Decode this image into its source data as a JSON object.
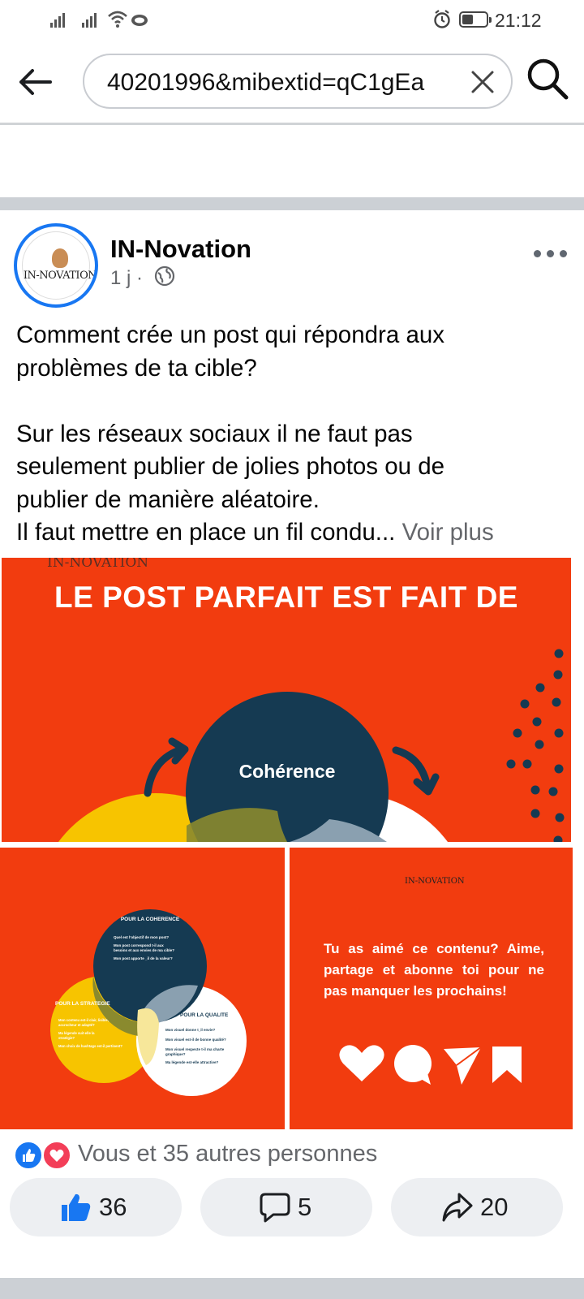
{
  "status_bar": {
    "time": "21:12",
    "icons": [
      "signal-icon",
      "signal-icon",
      "wifi-icon",
      "cloud-icon",
      "alarm-icon",
      "battery-icon"
    ]
  },
  "url_bar": {
    "url_text": "40201996&mibextid=qC1gEa",
    "icons": [
      "back-arrow-icon",
      "clear-icon",
      "search-icon"
    ]
  },
  "post": {
    "page_name": "IN-Novation",
    "avatar_text": "IN-NOVATION",
    "time_ago": "1 j",
    "separator": "·",
    "text_lines": [
      "Comment crée un post qui répondra aux",
      "problèmes de ta cible?",
      "",
      "Sur les réseaux sociaux il ne faut pas",
      "seulement publier de jolies photos ou de",
      "publier de manière aléatoire.",
      "Il faut mettre en place un fil condu..."
    ],
    "see_more": "Voir plus",
    "images": {
      "main": {
        "logo": "IN-NOVATION",
        "title": "LE POST PARFAIT EST FAIT DE",
        "circle_label": "Cohérence",
        "colors": {
          "background": "#f23c0f",
          "navy": "#153a52",
          "yellow": "#f7c400",
          "white": "#ffffff"
        }
      },
      "left": {
        "top_title": "POUR LA COHERENCE",
        "top_lines": [
          "Quel est l'objectif de mon post?",
          "Mon post correspond t-il aux",
          "besoins et aux envies de ma cible?",
          "Mon post apporte _il de la valeur?"
        ],
        "left_title": "POUR LA STRATEGIE",
        "left_lines": [
          "Mon contenu est-il clair, lisible,",
          "accrocheur et adapté?",
          "Ma légende suit-elle la",
          "stratégie?",
          "Mon choix de hashtags est-il pertinent?"
        ],
        "right_title": "POUR LA QUALITE",
        "right_lines": [
          "Mon visuel donne t_il envie?",
          "Mon visuel est-il de bonne qualité?",
          "Mon visuel respecte t-il ma charte",
          "graphique?",
          "Ma légende est-elle attractive?"
        ]
      },
      "right": {
        "logo": "IN-NOVATION",
        "text": "Tu as aimé ce contenu? Aime, partage et abonne toi pour ne pas manquer les prochains!",
        "icons": [
          "heart-icon",
          "comment-bubble-icon",
          "send-icon",
          "bookmark-icon"
        ]
      }
    },
    "reactions": {
      "summary": "Vous et 35 autres personnes",
      "icons": [
        "like-reaction-icon",
        "love-reaction-icon"
      ]
    },
    "actions": {
      "like_count": "36",
      "comment_count": "5",
      "share_count": "20",
      "icons": [
        "thumbs-up-icon",
        "comment-icon",
        "share-icon"
      ]
    }
  }
}
